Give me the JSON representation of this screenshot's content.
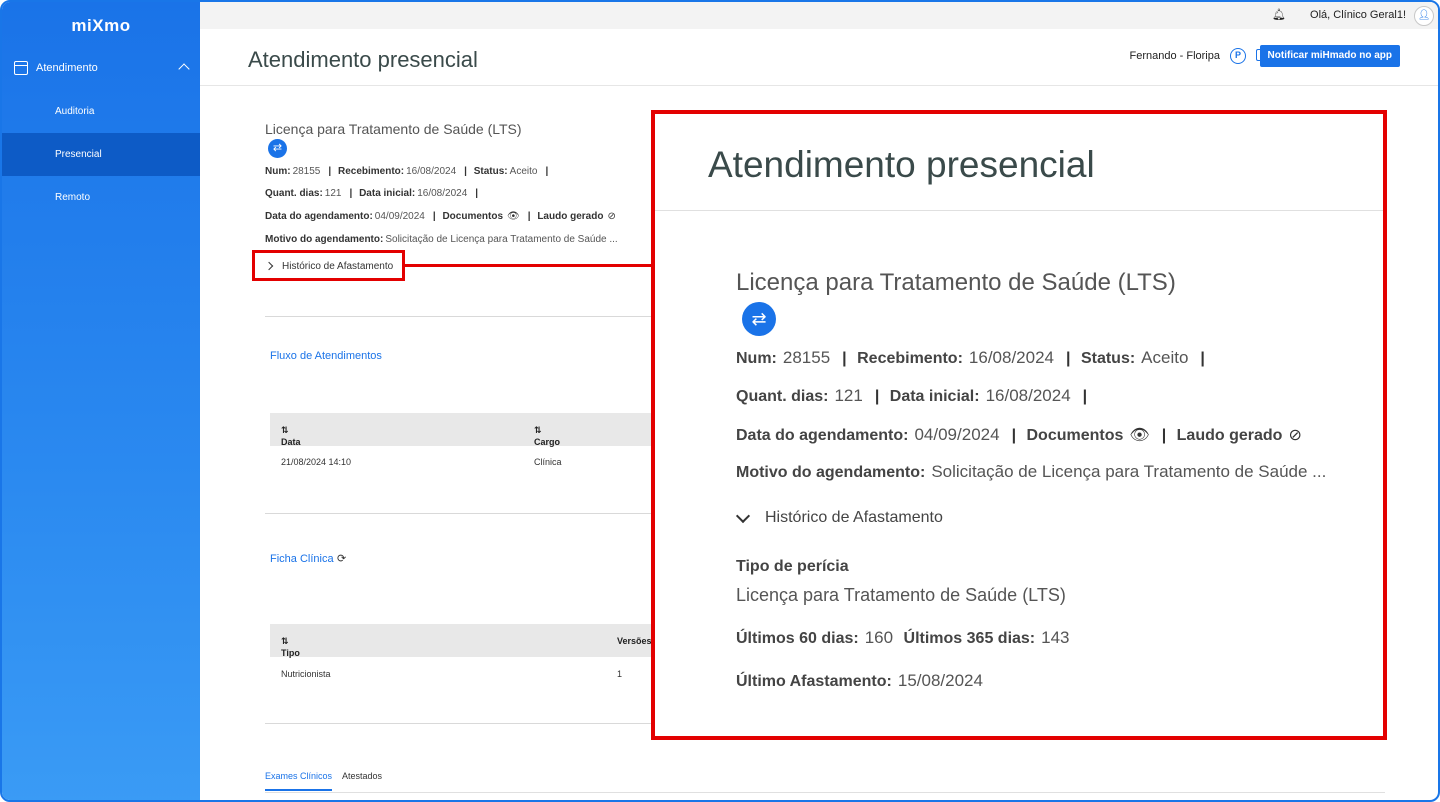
{
  "sidebar": {
    "logo": "miXmo",
    "group_label": "Atendimento",
    "items": [
      {
        "label": "Auditoria"
      },
      {
        "label": "Presencial"
      },
      {
        "label": "Remoto"
      }
    ]
  },
  "topbar": {
    "greeting": "Olá, Clínico Geral1!"
  },
  "header": {
    "title": "Atendimento presencial",
    "location": "Fernando - Floripa",
    "p_badge": "P",
    "notify_button": "Notificar miHmado no app"
  },
  "details": {
    "title": "Licença para Tratamento de Saúde (LTS)",
    "num_label": "Num:",
    "num": "28155",
    "recebimento_label": "Recebimento:",
    "recebimento": "16/08/2024",
    "status_label": "Status:",
    "status": "Aceito",
    "quant_label": "Quant. dias:",
    "quant": "121",
    "data_inicial_label": "Data inicial:",
    "data_inicial": "16/08/2024",
    "agendamento_label": "Data do agendamento:",
    "agendamento": "04/09/2024",
    "documentos_label": "Documentos",
    "laudo_label": "Laudo gerado",
    "motivo_label": "Motivo do agendamento:",
    "motivo": "Solicitação de Licença para Tratamento de Saúde ...",
    "historico_label": "Histórico de Afastamento"
  },
  "fluxo": {
    "title": "Fluxo de Atendimentos",
    "columns": [
      "Data",
      "Cargo"
    ],
    "rows": [
      [
        "21/08/2024 14:10",
        "Clínica"
      ]
    ]
  },
  "ficha": {
    "title": "Ficha Clínica",
    "columns": [
      "Tipo",
      "Versões"
    ],
    "rows": [
      [
        "Nutricionista",
        "1"
      ]
    ]
  },
  "tabs": [
    "Exames Clínicos",
    "Atestados"
  ],
  "zoom": {
    "title": "Atendimento presencial",
    "tipo_pericia_label": "Tipo de perícia",
    "tipo_pericia": "Licença para Tratamento de Saúde (LTS)",
    "ult60_label": "Últimos 60 dias:",
    "ult60": "160",
    "ult365_label": "Últimos 365 dias:",
    "ult365": "143",
    "ult_afast_label": "Último Afastamento:",
    "ult_afast": "15/08/2024"
  },
  "colors": {
    "primary": "#1a73e8",
    "highlight": "#e30000",
    "sidebar_active": "#0d5bc6"
  }
}
